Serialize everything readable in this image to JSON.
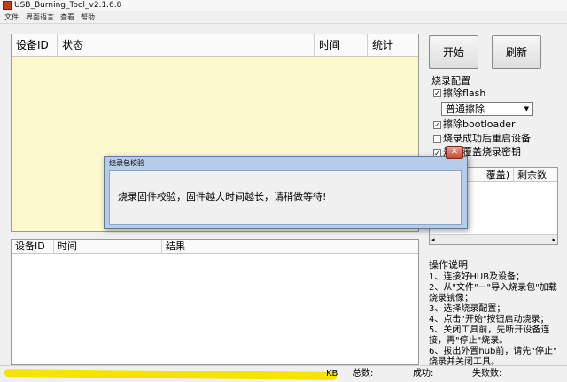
{
  "window": {
    "title": "USB_Burning_Tool_v2.1.6.8"
  },
  "menu": [
    "文件",
    "界面语言",
    "查看",
    "帮助"
  ],
  "device_table": {
    "columns": [
      "设备ID",
      "状态",
      "时间",
      "统计"
    ]
  },
  "result_table": {
    "columns": [
      "设备ID",
      "时间",
      "结果"
    ]
  },
  "buttons": {
    "start": "开始",
    "refresh": "刷新"
  },
  "config": {
    "title": "烧录配置",
    "erase_flash": {
      "label": "擦除flash",
      "checked": true
    },
    "erase_mode": "普通擦除",
    "erase_bootloader": {
      "label": "擦除bootloader",
      "checked": true
    },
    "reboot_after": {
      "label": "烧录成功后重启设备",
      "checked": false
    },
    "overwrite_key": {
      "label": "是否覆盖烧录密钥",
      "checked": true
    }
  },
  "right_table": {
    "col1": "覆盖)",
    "col2": "剩余数"
  },
  "instructions": {
    "title": "操作说明",
    "lines": [
      "1、连接好HUB及设备；",
      "2、从\"文件\"－\"导入烧录包\"加载",
      "烧录镜像；",
      "3、选择烧录配置；",
      "4、点击\"开始\"按钮启动烧录；",
      "5、关闭工具前，先断开设备连",
      "接，再\"停止\"烧录。",
      "6、拔出外置hub前，请先\"停止\"",
      "烧录并关闭工具。"
    ]
  },
  "status": {
    "tail": "KB",
    "total": "总数:",
    "success": "成功:",
    "fail": "失败数:"
  },
  "dialog": {
    "title": "烧录包校验",
    "message": "烧录固件校验，固件越大时间越长，请稍做等待!"
  },
  "colors": {
    "device_table_bg": "#fcf9cf",
    "dialog_frame": "#b5cde8",
    "highlight": "#f5e400"
  }
}
